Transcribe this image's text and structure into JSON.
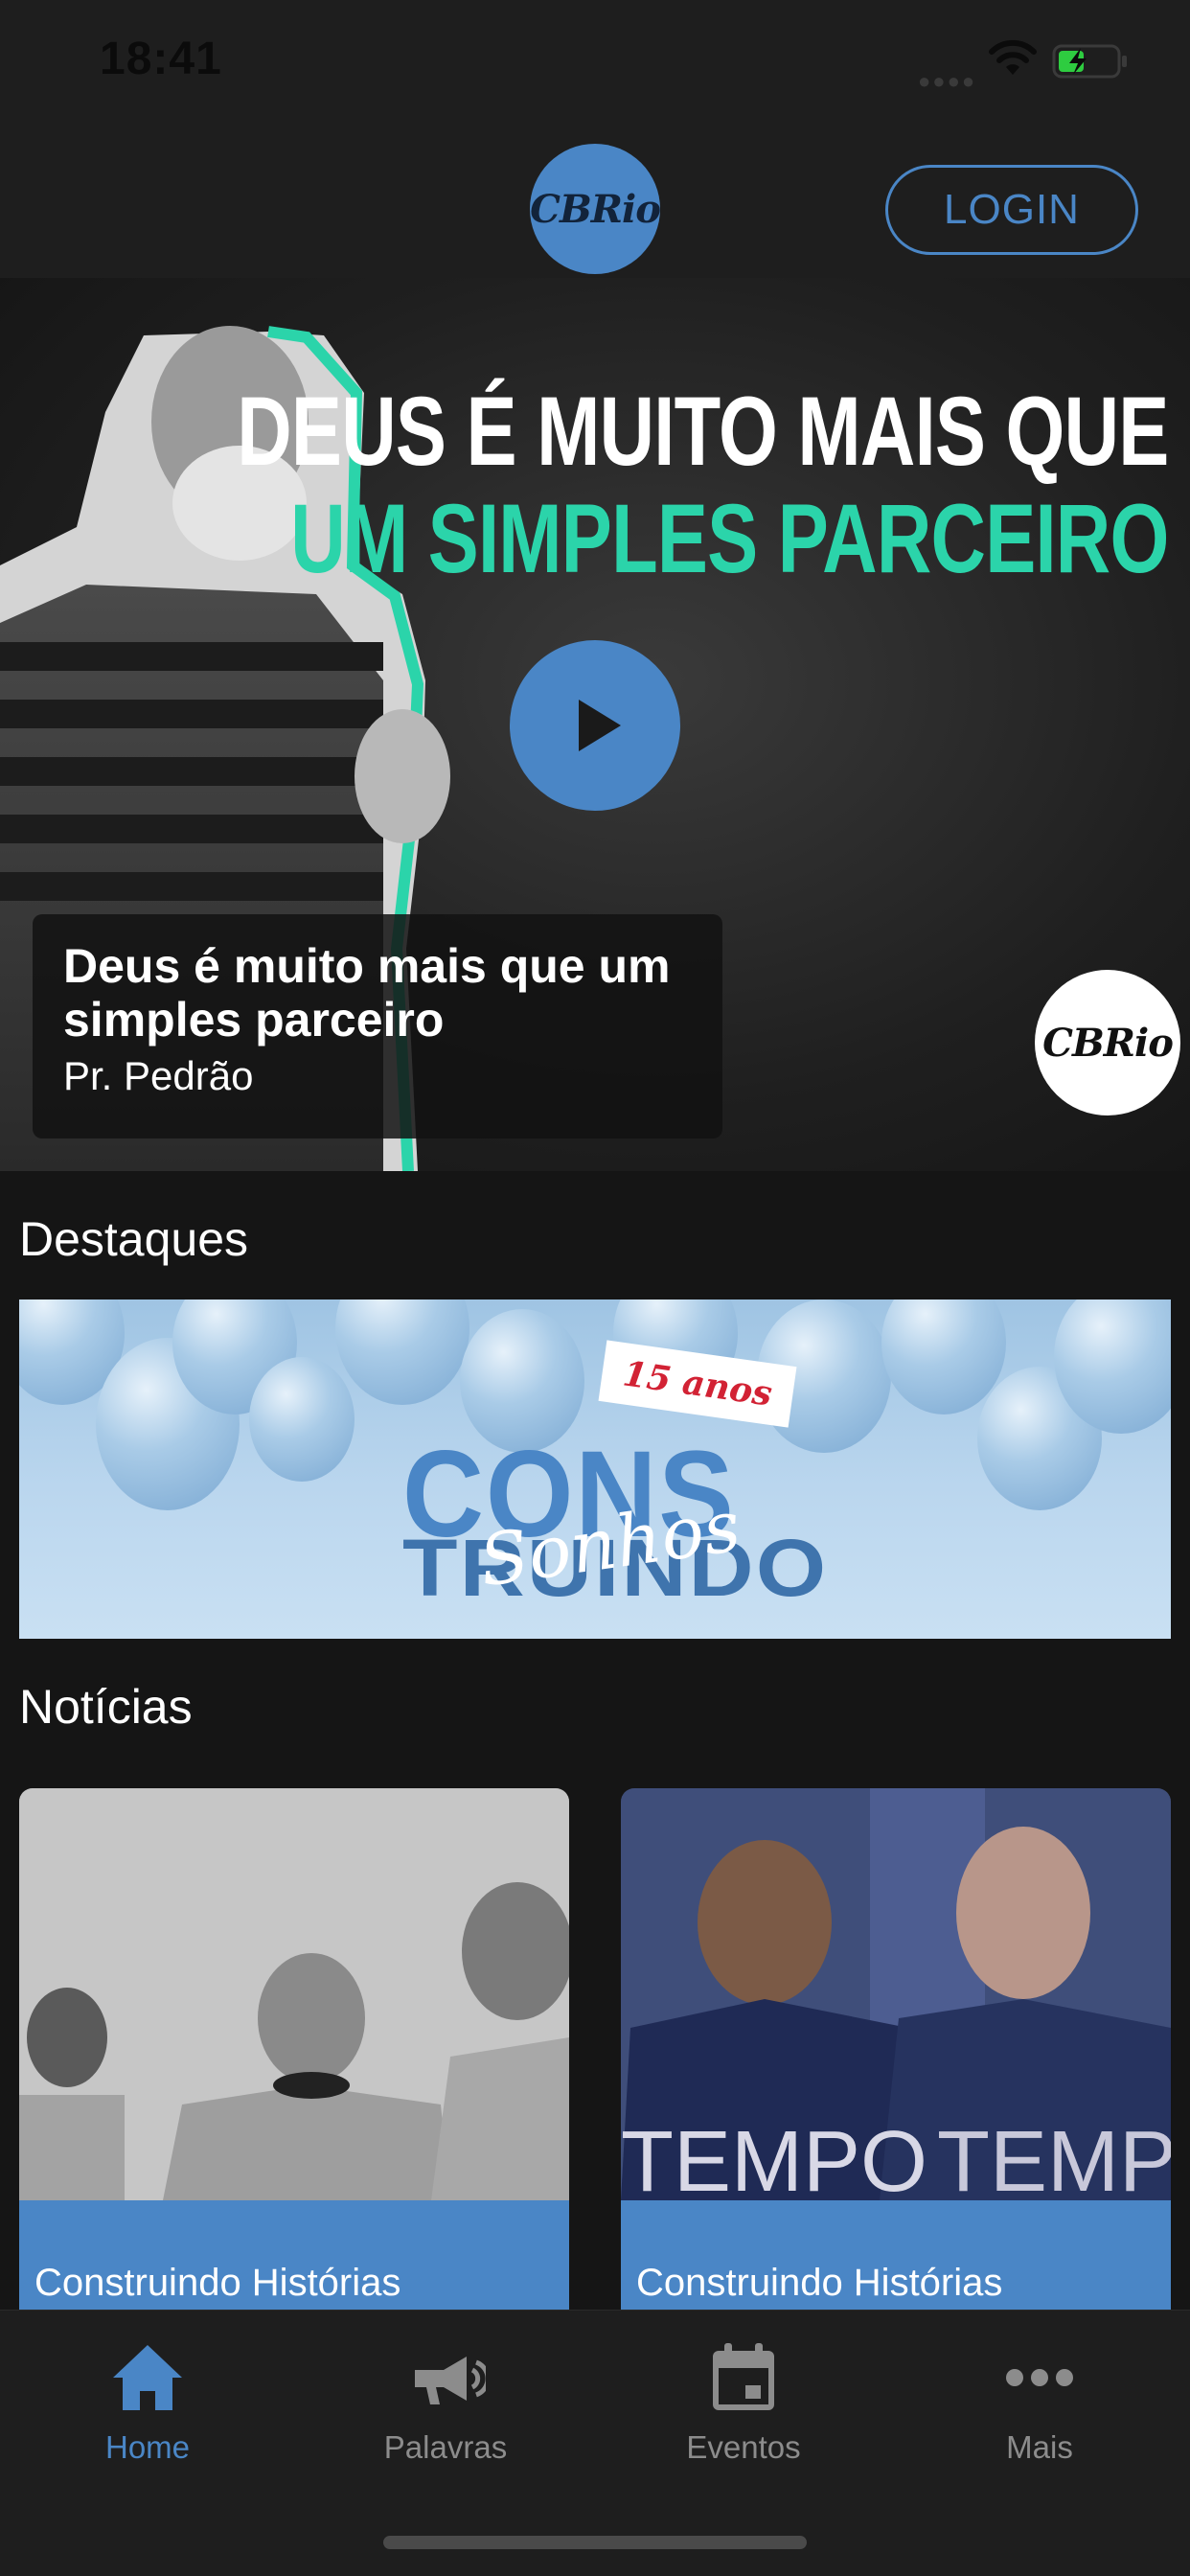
{
  "status_bar": {
    "time": "18:41",
    "icons": [
      "signal-icon",
      "wifi-icon",
      "battery-charging-icon"
    ]
  },
  "header": {
    "logo_text": "CBRio",
    "login_label": "LOGIN"
  },
  "hero": {
    "headline_line1": "DEUS É MUITO MAIS QUE",
    "headline_line2": "UM SIMPLES PARCEIRO",
    "caption_title": "Deus é muito mais que um simples parceiro",
    "caption_speaker": "Pr. Pedrão",
    "watermark_logo": "CBRio",
    "play_icon": "play-icon"
  },
  "destaques": {
    "title": "Destaques",
    "banner": {
      "tag": "15 anos",
      "word1": "CONS",
      "word2": "TRUINDO",
      "script": "Sonhos"
    }
  },
  "noticias": {
    "title": "Notícias",
    "cards": [
      {
        "label": "Construindo Histórias"
      },
      {
        "label": "Construindo Histórias"
      }
    ]
  },
  "tabs": [
    {
      "label": "Home",
      "icon": "home-icon",
      "active": true
    },
    {
      "label": "Palavras",
      "icon": "megaphone-icon",
      "active": false
    },
    {
      "label": "Eventos",
      "icon": "calendar-icon",
      "active": false
    },
    {
      "label": "Mais",
      "icon": "more-icon",
      "active": false
    }
  ],
  "colors": {
    "accent": "#4a86c6",
    "teal": "#2bd4aa",
    "background": "#151515",
    "bar": "#1e1e1e",
    "inactive_tab": "#8c8c8c"
  }
}
